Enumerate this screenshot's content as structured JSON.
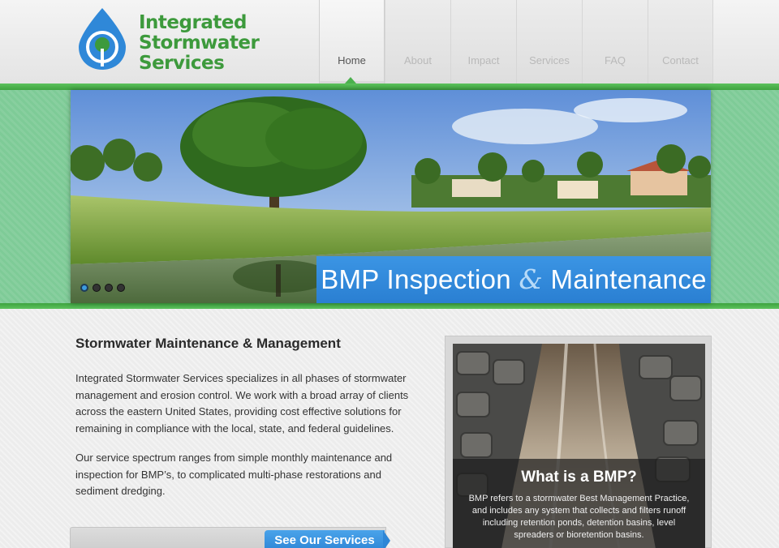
{
  "brand": {
    "name_line1": "Integrated",
    "name_line2": "Stormwater",
    "name_line3": "Services",
    "logo_icon": "water-drop-icon",
    "green": "#3d9a3c",
    "blue": "#2f88d8"
  },
  "nav": {
    "items": [
      {
        "label": "Home",
        "active": true
      },
      {
        "label": "About",
        "active": false
      },
      {
        "label": "Impact",
        "active": false
      },
      {
        "label": "Services",
        "active": false
      },
      {
        "label": "FAQ",
        "active": false
      },
      {
        "label": "Contact",
        "active": false
      }
    ]
  },
  "slider": {
    "caption_part1": "BMP Inspection",
    "caption_amp": "&",
    "caption_part2": "Maintenance",
    "slide_count": 4,
    "active_slide": 1
  },
  "main": {
    "heading": "Stormwater Maintenance & Management",
    "paragraph1": "Integrated Stormwater Services specializes in all phases of stormwater management and erosion control.  We work with a broad array of clients across the eastern United States, providing cost effective solutions for remaining in compliance with the local, state, and federal guidelines.",
    "paragraph2": "Our service spectrum ranges from simple monthly maintenance and inspection for BMP’s, to complicated multi-phase restorations and sediment dredging.",
    "cta_label": "See Our Services"
  },
  "bmp_card": {
    "title": "What is a BMP?",
    "text": "BMP refers to a stormwater Best Management Practice, and includes any system that collects and filters runoff including retention ponds, detention basins, level spreaders or bioretention basins."
  }
}
